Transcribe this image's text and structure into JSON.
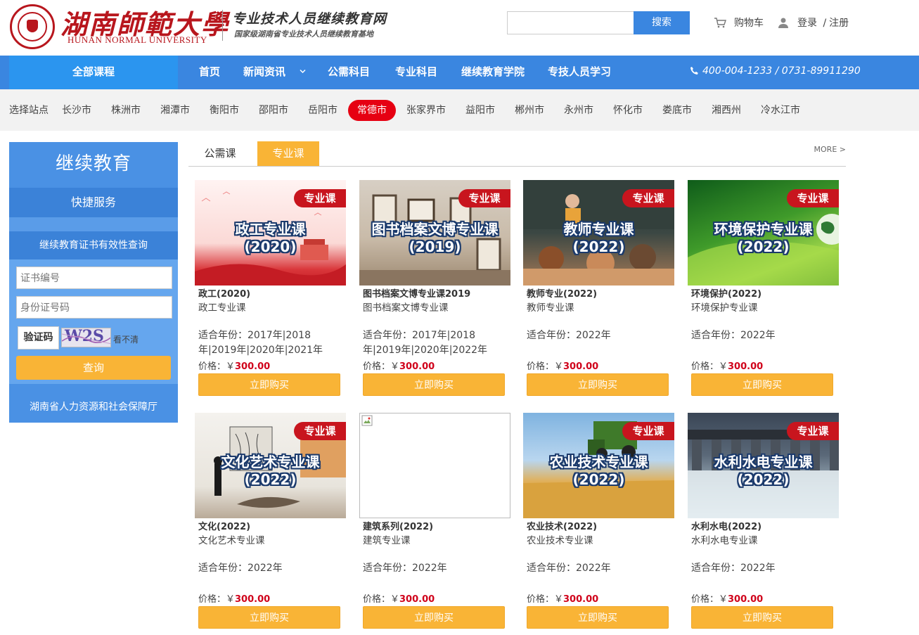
{
  "header": {
    "university_cn": "湖南師範大學",
    "university_en": "HUNAN NORMAL UNIVERSITY",
    "site_title": "专业技术人员继续教育网",
    "site_subtitle": "国家级湖南省专业技术人员继续教育基地",
    "search_button": "搜索",
    "search_placeholder": "",
    "cart_label": "购物车",
    "login_label": "登录",
    "login_sep": "/",
    "register_label": "注册"
  },
  "nav": {
    "all_courses": "全部课程",
    "items": [
      "首页",
      "新闻资讯",
      "公需科目",
      "专业科目",
      "继续教育学院",
      "专技人员学习"
    ],
    "phone": "400-004-1233 / 0731-89911290"
  },
  "cities": {
    "label": "选择站点",
    "items": [
      "长沙市",
      "株洲市",
      "湘潭市",
      "衡阳市",
      "邵阳市",
      "岳阳市",
      "常德市",
      "张家界市",
      "益阳市",
      "郴州市",
      "永州市",
      "怀化市",
      "娄底市",
      "湘西州",
      "冷水江市"
    ],
    "active": "常德市"
  },
  "sidebar": {
    "title": "继续教育",
    "quick": "快捷服务",
    "cert_query": "继续教育证书有效性查询",
    "cert_no_placeholder": "证书编号",
    "id_no_placeholder": "身份证号码",
    "captcha_label": "验证码",
    "captcha_text": "W2S",
    "captcha_refresh": "看不清",
    "query_button": "查询",
    "footer_link": "湖南省人力资源和社会保障厅"
  },
  "tabs": {
    "items": [
      "公需课",
      "专业课"
    ],
    "active": "专业课",
    "more": "MORE >"
  },
  "courses": [
    {
      "thumb_title_1": "政工专业课",
      "thumb_title_2": "(2020)",
      "badge": "专业课",
      "name": "政工(2020)",
      "desc": "政工专业课",
      "years": "适合年份：2017年|2018年|2019年|2020年|2021年",
      "price_label": "价格：￥",
      "price": "300.00",
      "buy": "立即购买"
    },
    {
      "thumb_title_1": "图书档案文博专业课",
      "thumb_title_2": "(2019)",
      "badge": "专业课",
      "name": "图书档案文博专业课2019",
      "desc": "图书档案文博专业课",
      "years": "适合年份：2017年|2018年|2019年|2020年|2022年",
      "price_label": "价格：￥",
      "price": "300.00",
      "buy": "立即购买"
    },
    {
      "thumb_title_1": "教师专业课",
      "thumb_title_2": "(2022)",
      "badge": "专业课",
      "name": "教师专业(2022)",
      "desc": "教师专业课",
      "years": "适合年份：2022年",
      "price_label": "价格：￥",
      "price": "300.00",
      "buy": "立即购买"
    },
    {
      "thumb_title_1": "环境保护专业课",
      "thumb_title_2": "(2022)",
      "badge": "专业课",
      "name": "环境保护(2022)",
      "desc": "环境保护专业课",
      "years": "适合年份：2022年",
      "price_label": "价格：￥",
      "price": "300.00",
      "buy": "立即购买"
    },
    {
      "thumb_title_1": "文化艺术专业课",
      "thumb_title_2": "(2022)",
      "badge": "专业课",
      "name": "文化(2022)",
      "desc": "文化艺术专业课",
      "years": "适合年份：2022年",
      "price_label": "价格：￥",
      "price": "300.00",
      "buy": "立即购买"
    },
    {
      "thumb_title_1": "",
      "thumb_title_2": "",
      "badge": "",
      "name": "建筑系列(2022)",
      "desc": "建筑专业课",
      "years": "适合年份：2022年",
      "price_label": "价格：￥",
      "price": "300.00",
      "buy": "立即购买"
    },
    {
      "thumb_title_1": "农业技术专业课",
      "thumb_title_2": "(2022)",
      "badge": "专业课",
      "name": "农业技术(2022)",
      "desc": "农业技术专业课",
      "years": "适合年份：2022年",
      "price_label": "价格：￥",
      "price": "300.00",
      "buy": "立即购买"
    },
    {
      "thumb_title_1": "水利水电专业课",
      "thumb_title_2": "(2022)",
      "badge": "专业课",
      "name": "水利水电(2022)",
      "desc": "水利水电专业课",
      "years": "适合年份：2022年",
      "price_label": "价格：￥",
      "price": "300.00",
      "buy": "立即购买"
    }
  ],
  "colors": {
    "nav_blue": "#3a86e0",
    "accent_orange": "#f9b436",
    "active_red": "#e60012",
    "price_red": "#d0021b",
    "brand_red": "#b8161d"
  }
}
